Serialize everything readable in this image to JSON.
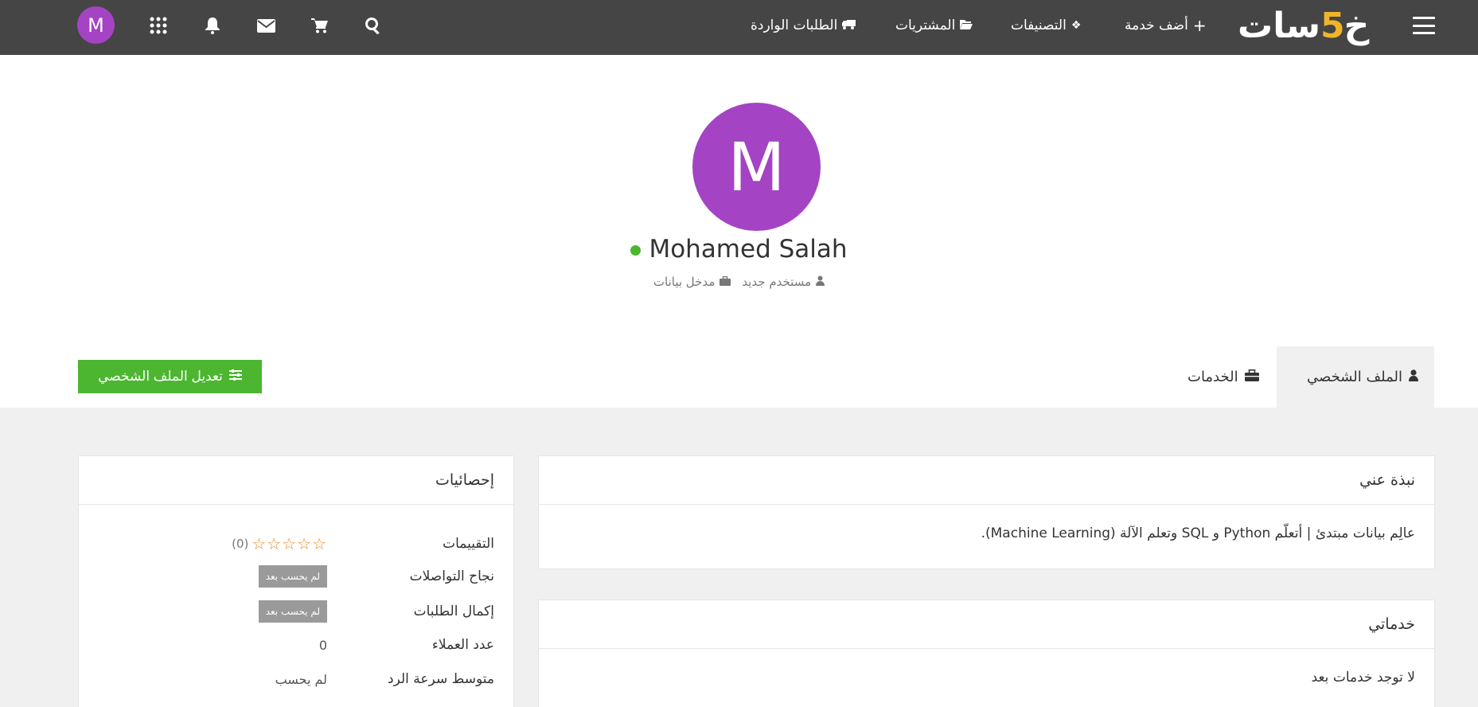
{
  "nav": {
    "logo_text_a": "خ",
    "logo_five": "5",
    "logo_text_b": "سات",
    "add_service": "أضف خدمة",
    "categories": "التصنيفات",
    "purchases": "المشتريات",
    "incoming_orders": "الطلبات الواردة",
    "avatar_letter": "M"
  },
  "profile": {
    "avatar_letter": "M",
    "name": "Mohamed Salah",
    "role": "مستخدم جديد",
    "specialty": "مدخل بيانات",
    "online_color": "#4cb630"
  },
  "tabs": {
    "profile": "الملف الشخصي",
    "services": "الخدمات"
  },
  "edit_button": "تعديل الملف الشخصي",
  "about": {
    "title": "نبذة عني",
    "text": "عالِم بيانات مبتدئ | أتعلّم Python و SQL وتعلم الآلة (Machine Learning)."
  },
  "my_services": {
    "title": "خدماتي",
    "empty": "لا توجد خدمات بعد"
  },
  "stats": {
    "title": "إحصائيات",
    "rows": [
      {
        "label": "التقييمات",
        "value": "(0)",
        "stars": "☆☆☆☆☆"
      },
      {
        "label": "نجاح التواصلات",
        "value": "لم يحسب بعد"
      },
      {
        "label": "إكمال الطلبات",
        "value": "لم يحسب بعد"
      },
      {
        "label": "عدد العملاء",
        "value": "0"
      },
      {
        "label": "متوسط سرعة الرد",
        "value": "لم يحسب"
      }
    ]
  },
  "colors": {
    "topbar": "#454545",
    "accent_green": "#4cb630",
    "avatar_purple": "#a443c3",
    "star_orange": "#f08a2c",
    "logo_yellow": "#f0b429"
  }
}
